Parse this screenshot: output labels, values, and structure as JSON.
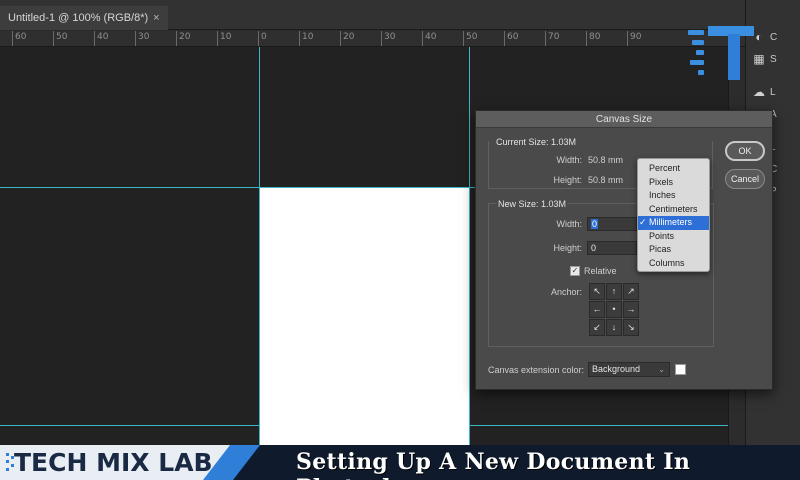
{
  "document_tab": {
    "title": "Untitled-1 @ 100% (RGB/8*)",
    "close": "×"
  },
  "ruler": {
    "ticks": [
      "60",
      "50",
      "40",
      "30",
      "20",
      "10",
      "0",
      "10",
      "20",
      "30",
      "40",
      "50",
      "60",
      "70",
      "80",
      "90"
    ]
  },
  "dialog": {
    "title": "Canvas Size",
    "current_size": {
      "label": "Current Size: 1.03M",
      "width_label": "Width:",
      "width_value": "50.8 mm",
      "height_label": "Height:",
      "height_value": "50.8 mm"
    },
    "new_size": {
      "label": "New Size: 1.03M",
      "width_label": "Width:",
      "width_value": "0",
      "height_label": "Height:",
      "height_value": "0",
      "relative_label": "Relative",
      "relative_checked": true,
      "anchor_label": "Anchor:",
      "anchor_arrows": [
        "↖",
        "↑",
        "↗",
        "←",
        "•",
        "→",
        "↙",
        "↓",
        "↘"
      ]
    },
    "extension_color_label": "Canvas extension color:",
    "extension_color_value": "Background",
    "ok_label": "OK",
    "cancel_label": "Cancel"
  },
  "units_menu": {
    "items": [
      "Percent",
      "Pixels",
      "Inches",
      "Centimeters",
      "Millimeters",
      "Points",
      "Picas",
      "Columns"
    ],
    "selected": "Millimeters",
    "check": "✓"
  },
  "right_panel": {
    "letters": [
      "C",
      "S",
      "L",
      "A",
      "L",
      "C",
      "P"
    ]
  },
  "banner": {
    "brand": "TECH MIX LAB",
    "title": "Setting Up A New Document In Photoshop"
  },
  "colors": {
    "guide": "#3fb6c6",
    "accent": "#2d6fd6",
    "brand_blue": "#2f7fd8"
  }
}
